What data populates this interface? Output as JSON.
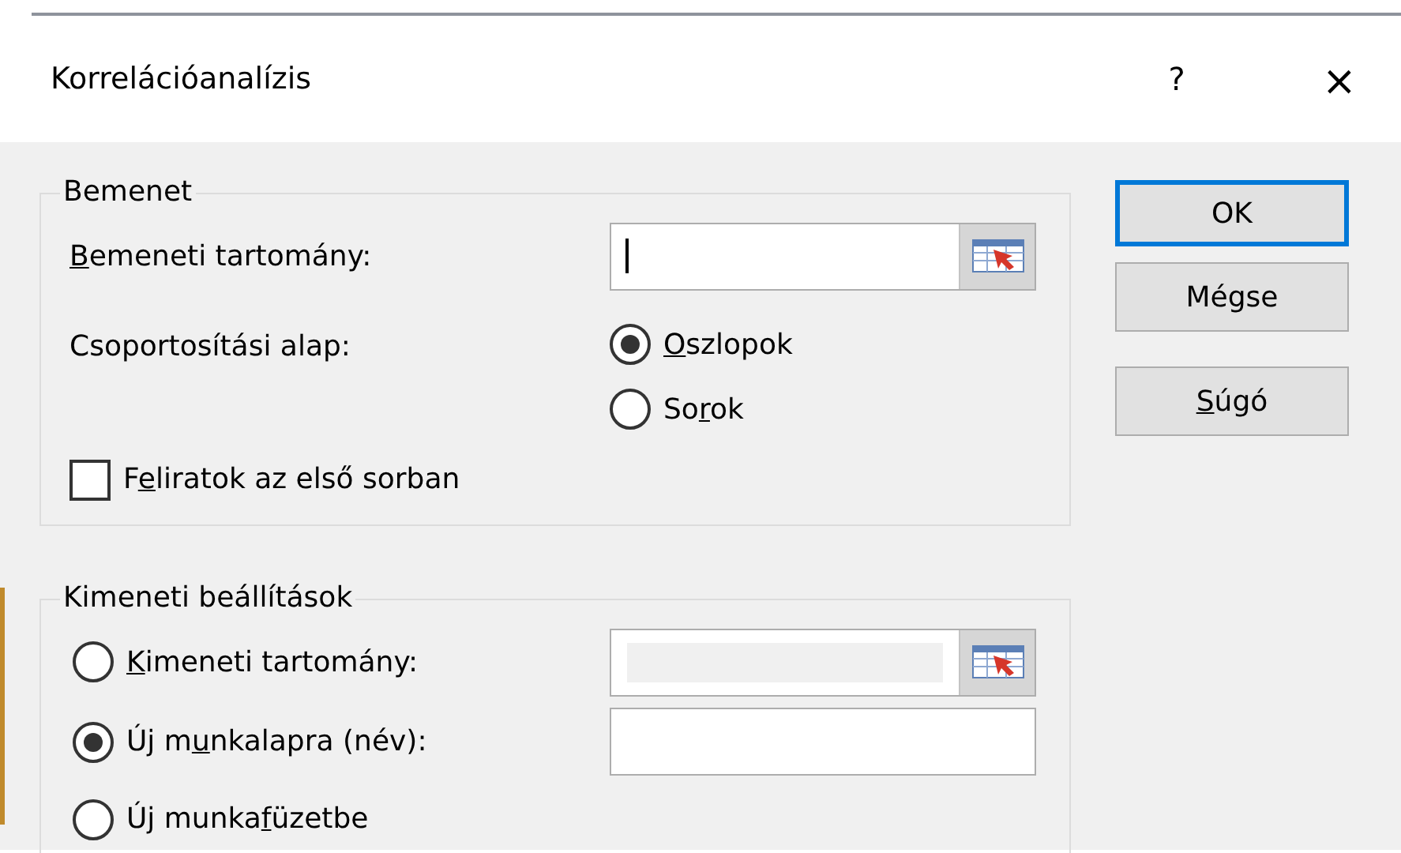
{
  "window": {
    "title": "Korrelációanalízis",
    "help": "?",
    "close": "×"
  },
  "groups": [
    {
      "title": "Bemenet",
      "rows": [
        {
          "kind": "range_field",
          "label": {
            "key": "B",
            "post": "emeneti tartomány:"
          },
          "focused": true
        },
        {
          "kind": "radio_group",
          "label": "Csoportosítási alap:",
          "options": [
            {
              "label": {
                "key": "O",
                "post": "szlopok"
              },
              "selected": true
            },
            {
              "label": {
                "pre": "So",
                "key": "r",
                "post": "ok"
              },
              "selected": false
            }
          ]
        },
        {
          "kind": "checkbox",
          "label": {
            "pre": "F",
            "key": "e",
            "post": "liratok az első sorban"
          },
          "checked": false
        }
      ]
    },
    {
      "title": "Kimeneti beállítások",
      "rows": [
        {
          "kind": "radio_range_field",
          "label": {
            "key": "K",
            "post": "imeneti tartomány:"
          },
          "selected": false,
          "disabled": true
        },
        {
          "kind": "radio_field",
          "label": {
            "pre": "Új m",
            "key": "u",
            "post": "nkalapra (név):"
          },
          "selected": true
        },
        {
          "kind": "radio",
          "label": {
            "pre": "Új munka",
            "key": "f",
            "post": "üzetbe"
          },
          "selected": false
        }
      ]
    }
  ],
  "buttons": [
    {
      "label": {
        "pre": "OK"
      },
      "default": true
    },
    {
      "label": {
        "pre": "Mégse"
      },
      "default": false
    },
    {
      "label": {
        "key": "S",
        "post": "úgó"
      },
      "default": false
    }
  ]
}
